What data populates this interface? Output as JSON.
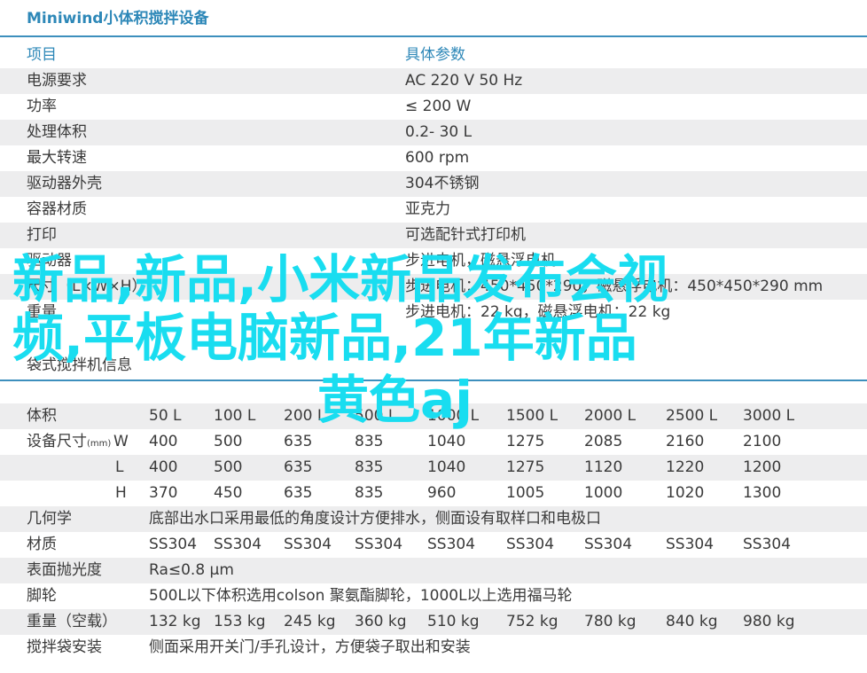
{
  "title": "Miniwind小体积搅拌设备",
  "specs_header": {
    "key": "项目",
    "value": "具体参数"
  },
  "specs": [
    {
      "key": "电源要求",
      "value": "AC 220  V 50 Hz"
    },
    {
      "key": "功率",
      "value": "≤ 200 W"
    },
    {
      "key": "处理体积",
      "value": "0.2- 30 L"
    },
    {
      "key": "最大转速",
      "value": "600  rpm"
    },
    {
      "key": "驱动器外壳",
      "value": "304不锈钢"
    },
    {
      "key": "容器材质",
      "value": "亚克力"
    },
    {
      "key": "打印",
      "value": "可选配针式打印机"
    },
    {
      "key": "驱动器",
      "value": "步进电机，磁悬浮电机"
    },
    {
      "key": "尺寸（L×W×H）",
      "value": "步进电机：450*450*290，磁悬浮电机：450*450*290 mm"
    },
    {
      "key": "重量",
      "value": "步进电机：22 kg，磁悬浮电机：22 kg"
    }
  ],
  "section2_title": "袋式搅拌机信息",
  "bag": {
    "volume_label": "体积",
    "volumes": [
      "50 L",
      "100 L",
      "200 L",
      "500 L",
      "1000 L",
      "1500 L",
      "2000 L",
      "2500 L",
      "3000 L"
    ],
    "size_label": "设备尺寸",
    "size_unit": "(mm)",
    "dim_w": "W",
    "dim_l": "L",
    "dim_h": "H",
    "w": [
      "400",
      "500",
      "635",
      "835",
      "1040",
      "1275",
      "2085",
      "2160",
      "2100"
    ],
    "l": [
      "400",
      "500",
      "635",
      "835",
      "1040",
      "1275",
      "1120",
      "1220",
      "1200"
    ],
    "h": [
      "370",
      "450",
      "635",
      "835",
      "960",
      "1005",
      "1000",
      "1020",
      "1300"
    ],
    "geometry_label": "几何学",
    "geometry": "底部出水口采用最低的角度设计方便排水，侧面设有取样口和电极口",
    "material_label": "材质",
    "material": [
      "SS304",
      "SS304",
      "SS304",
      "SS304",
      "SS304",
      "SS304",
      "SS304",
      "SS304",
      "SS304"
    ],
    "polish_label": "表面抛光度",
    "polish": "Ra≤0.8 μm",
    "caster_label": "脚轮",
    "caster": "500L以下体积选用colson 聚氨酯脚轮，1000L以上选用福马轮",
    "weight_label": "重量（空载）",
    "weight": [
      "132 kg",
      "153 kg",
      "245 kg",
      "360 kg",
      "510 kg",
      "752 kg",
      "780 kg",
      "840 kg",
      "980 kg"
    ],
    "install_label": "搅拌袋安装",
    "install": "侧面采用开关门/手孔设计，方便袋子取出和安装"
  },
  "overlay": {
    "line1": "新品,新品,小米新品发布会视",
    "line2": "频,平板电脑新品,21年新品",
    "line3": "黄色aj"
  },
  "colors": {
    "accent": "#2e88b8",
    "rule": "#3d8fbd",
    "stripe": "#ededee",
    "overlay": "#19ddf0"
  }
}
